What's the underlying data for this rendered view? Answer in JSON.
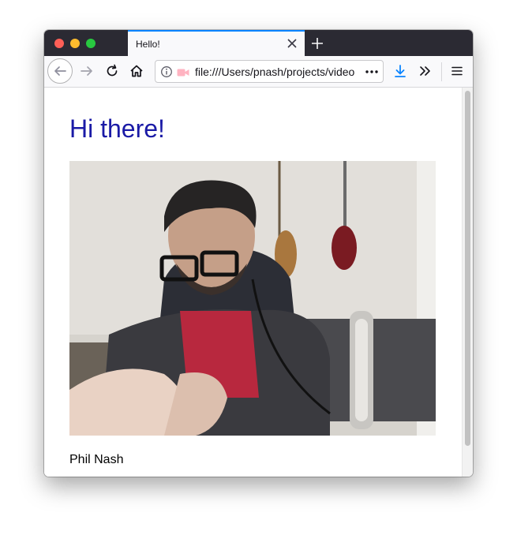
{
  "tab": {
    "title": "Hello!"
  },
  "urlbar": {
    "url": "file:///Users/pnash/projects/video"
  },
  "page": {
    "heading": "Hi there!",
    "caption": "Phil Nash"
  },
  "colors": {
    "heading": "#1a1aa6",
    "tab_accent": "#0a84ff",
    "download_icon": "#0a84ff"
  },
  "icons": {
    "back": "back-arrow-icon",
    "forward": "forward-arrow-icon",
    "reload": "reload-icon",
    "home": "home-icon",
    "info": "info-icon",
    "camera": "camera-icon",
    "more": "more-dots-icon",
    "download": "download-icon",
    "overflow": "chevron-double-right-icon",
    "menu": "hamburger-menu-icon"
  }
}
